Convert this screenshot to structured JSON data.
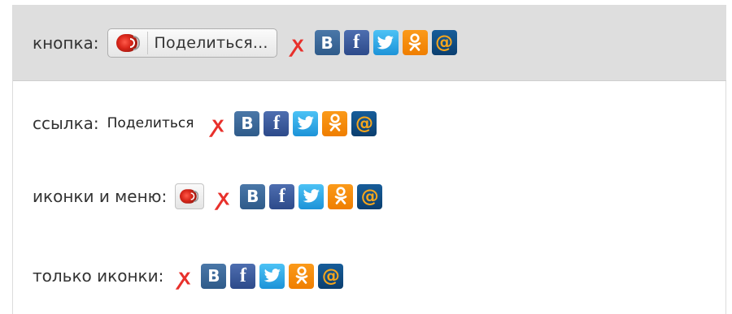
{
  "rows": {
    "button": {
      "label": "кнопка:",
      "button_text": "Поделиться..."
    },
    "link": {
      "label": "ссылка:",
      "link_text": "Поделиться"
    },
    "menu": {
      "label": "иконки и меню:"
    },
    "icons_only": {
      "label": "только иконки:"
    }
  },
  "services": [
    {
      "name": "moi-mir-icon",
      "glyph": "ꭗ",
      "color": "#e8302b"
    },
    {
      "name": "vkontakte-icon",
      "glyph": "B",
      "color": "#3b6ba0"
    },
    {
      "name": "facebook-icon",
      "glyph": "f",
      "color": "#3b5998"
    },
    {
      "name": "twitter-icon",
      "glyph": "",
      "color": "#2ea8e8"
    },
    {
      "name": "odnoklassniki-icon",
      "glyph": "",
      "color": "#f48b0b"
    },
    {
      "name": "mail-ru-icon",
      "glyph": "@",
      "color": "#f6a61c"
    }
  ]
}
